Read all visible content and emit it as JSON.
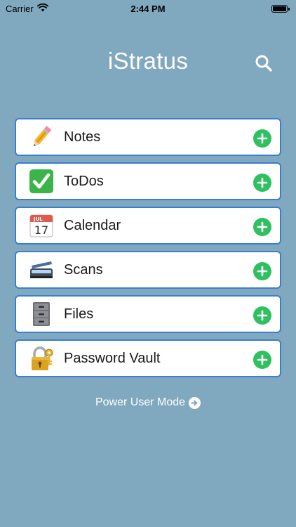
{
  "status_bar": {
    "carrier": "Carrier",
    "time": "2:44 PM"
  },
  "header": {
    "title": "iStratus",
    "search_icon": "search-icon"
  },
  "modules": [
    {
      "label": "Notes",
      "icon": "pencil-icon"
    },
    {
      "label": "ToDos",
      "icon": "checkbox-icon"
    },
    {
      "label": "Calendar",
      "icon": "calendar-icon",
      "calendar_month": "JUL",
      "calendar_day": "17"
    },
    {
      "label": "Scans",
      "icon": "scanner-icon"
    },
    {
      "label": "Files",
      "icon": "filing-cabinet-icon"
    },
    {
      "label": "Password Vault",
      "icon": "padlock-key-icon"
    }
  ],
  "footer": {
    "power_user_label": "Power User Mode",
    "arrow_icon": "arrow-circle-right-icon"
  },
  "colors": {
    "background": "#80a9bf",
    "row_border": "#3a7fd0",
    "add_button": "#2fc060"
  }
}
